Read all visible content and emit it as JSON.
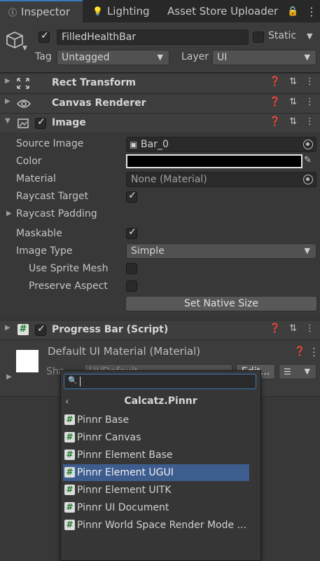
{
  "tabs": {
    "inspector": "Inspector",
    "lighting": "Lighting",
    "asset_store": "Asset Store Uploader"
  },
  "header": {
    "object_name": "FilledHealthBar",
    "static_label": "Static",
    "tag_label": "Tag",
    "tag_value": "Untagged",
    "layer_label": "Layer",
    "layer_value": "UI"
  },
  "components": {
    "rect_transform": "Rect Transform",
    "canvas_renderer": "Canvas Renderer",
    "image": "Image",
    "progress_bar": "Progress Bar (Script)"
  },
  "image_props": {
    "source_image_label": "Source Image",
    "source_image_value": "Bar_0",
    "color_label": "Color",
    "color_value": "#000000",
    "material_label": "Material",
    "material_value": "None (Material)",
    "raycast_target_label": "Raycast Target",
    "raycast_padding_label": "Raycast Padding",
    "maskable_label": "Maskable",
    "image_type_label": "Image Type",
    "image_type_value": "Simple",
    "use_sprite_mesh_label": "Use Sprite Mesh",
    "preserve_aspect_label": "Preserve Aspect",
    "set_native_size": "Set Native Size"
  },
  "material_section": {
    "title": "Default UI Material (Material)",
    "shader_label": "Sha",
    "shader_value": "UI/Default",
    "edit_button": "Edit..."
  },
  "popup": {
    "search_placeholder": "",
    "title": "Calcatz.Pinnr",
    "items": [
      "Pinnr Base",
      "Pinnr Canvas",
      "Pinnr Element Base",
      "Pinnr Element UGUI",
      "Pinnr Element UITK",
      "Pinnr UI Document",
      "Pinnr World Space Render Mode ..."
    ],
    "selected_index": 3
  },
  "colors": {
    "accent": "#3a79bb",
    "selection": "#3e5d8f",
    "background": "#383838"
  }
}
